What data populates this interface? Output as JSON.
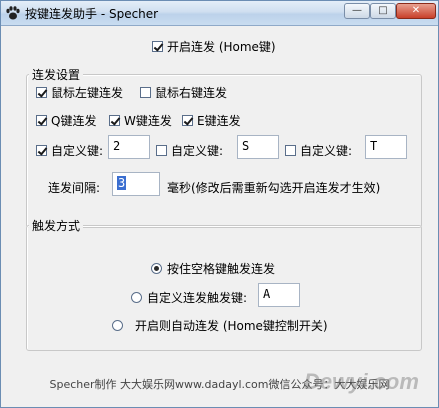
{
  "window": {
    "title": "按键连发助手 - Specher",
    "minimize_label": "—",
    "maximize_label": "□",
    "close_label": "✕"
  },
  "top": {
    "enable_label": "开启连发 (Home键)",
    "enable_checked": true
  },
  "repeat_settings": {
    "title": "连发设置",
    "mouse_left": {
      "label": "鼠标左键连发",
      "checked": true
    },
    "mouse_right": {
      "label": "鼠标右键连发",
      "checked": false
    },
    "key_q": {
      "label": "Q键连发",
      "checked": true
    },
    "key_w": {
      "label": "W键连发",
      "checked": true
    },
    "key_e": {
      "label": "E键连发",
      "checked": true
    },
    "custom": [
      {
        "label": "自定义键:",
        "checked": true,
        "value": "2"
      },
      {
        "label": "自定义键:",
        "checked": false,
        "value": "S"
      },
      {
        "label": "自定义键:",
        "checked": false,
        "value": "T"
      }
    ],
    "interval_label": "连发间隔:",
    "interval_value": "3",
    "interval_hint": "毫秒(修改后需重新勾选开启连发才生效)"
  },
  "trigger": {
    "title": "触发方式",
    "option_space": {
      "label": "按住空格键触发连发",
      "selected": true
    },
    "option_custom": {
      "label": "自定义连发触发键:",
      "selected": false,
      "value": "A"
    },
    "option_auto": {
      "label": "开启则自动连发 (Home键控制开关)",
      "selected": false
    }
  },
  "footer": {
    "text": "Specher制作 大大娱乐网www.dadayl.com微信公众号：大大娱乐网"
  },
  "watermark": "Dewyi.com"
}
